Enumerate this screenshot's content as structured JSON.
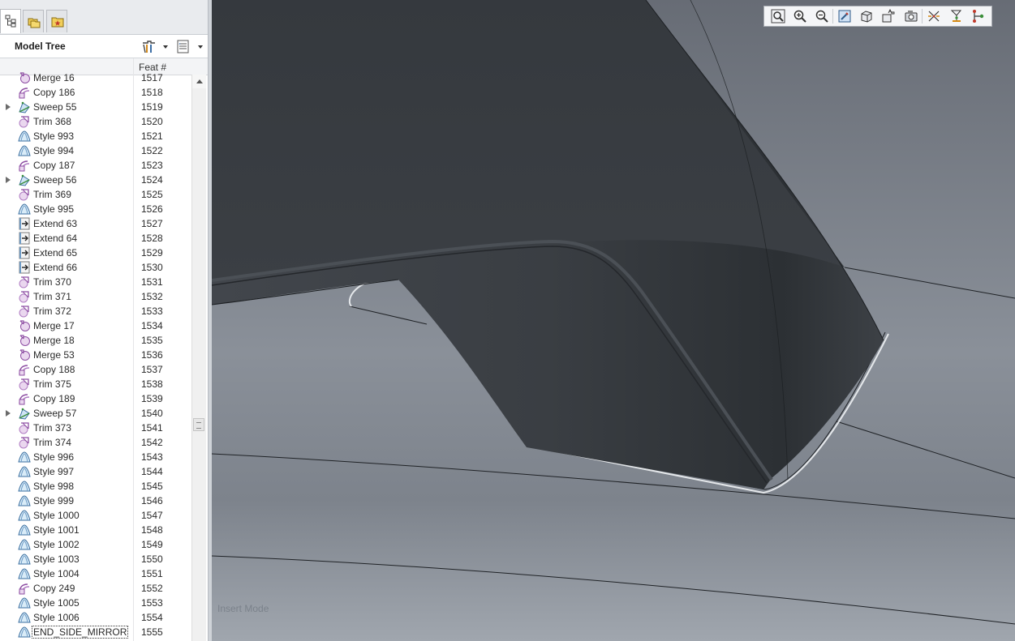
{
  "panel_tabs": [
    {
      "id": "model-tree",
      "icon": "model-tree-icon",
      "active": true
    },
    {
      "id": "folder-browser",
      "icon": "folder-browser-icon",
      "active": false
    },
    {
      "id": "favorites",
      "icon": "favorites-icon",
      "active": false
    }
  ],
  "model_tree": {
    "title": "Model Tree",
    "settings_icon": "tree-settings-icon",
    "columns_icon": "tree-columns-icon",
    "column_feat": "Feat #",
    "rows": [
      {
        "name": "Merge 16",
        "feat": "1517",
        "type": "merge",
        "expandable": false
      },
      {
        "name": "Copy 186",
        "feat": "1518",
        "type": "copy",
        "expandable": false
      },
      {
        "name": "Sweep 55",
        "feat": "1519",
        "type": "sweep",
        "expandable": true
      },
      {
        "name": "Trim 368",
        "feat": "1520",
        "type": "trim",
        "expandable": false
      },
      {
        "name": "Style 993",
        "feat": "1521",
        "type": "style",
        "expandable": false
      },
      {
        "name": "Style 994",
        "feat": "1522",
        "type": "style",
        "expandable": false
      },
      {
        "name": "Copy 187",
        "feat": "1523",
        "type": "copy",
        "expandable": false
      },
      {
        "name": "Sweep 56",
        "feat": "1524",
        "type": "sweep",
        "expandable": true
      },
      {
        "name": "Trim 369",
        "feat": "1525",
        "type": "trim",
        "expandable": false
      },
      {
        "name": "Style 995",
        "feat": "1526",
        "type": "style",
        "expandable": false
      },
      {
        "name": "Extend 63",
        "feat": "1527",
        "type": "extend",
        "expandable": false
      },
      {
        "name": "Extend 64",
        "feat": "1528",
        "type": "extend",
        "expandable": false
      },
      {
        "name": "Extend 65",
        "feat": "1529",
        "type": "extend",
        "expandable": false
      },
      {
        "name": "Extend 66",
        "feat": "1530",
        "type": "extend",
        "expandable": false
      },
      {
        "name": "Trim 370",
        "feat": "1531",
        "type": "trim",
        "expandable": false
      },
      {
        "name": "Trim 371",
        "feat": "1532",
        "type": "trim",
        "expandable": false
      },
      {
        "name": "Trim 372",
        "feat": "1533",
        "type": "trim",
        "expandable": false
      },
      {
        "name": "Merge 17",
        "feat": "1534",
        "type": "merge",
        "expandable": false
      },
      {
        "name": "Merge 18",
        "feat": "1535",
        "type": "merge",
        "expandable": false
      },
      {
        "name": "Merge 53",
        "feat": "1536",
        "type": "merge",
        "expandable": false
      },
      {
        "name": "Copy 188",
        "feat": "1537",
        "type": "copy",
        "expandable": false
      },
      {
        "name": "Trim 375",
        "feat": "1538",
        "type": "trim",
        "expandable": false
      },
      {
        "name": "Copy 189",
        "feat": "1539",
        "type": "copy",
        "expandable": false
      },
      {
        "name": "Sweep 57",
        "feat": "1540",
        "type": "sweep",
        "expandable": true
      },
      {
        "name": "Trim 373",
        "feat": "1541",
        "type": "trim",
        "expandable": false
      },
      {
        "name": "Trim 374",
        "feat": "1542",
        "type": "trim",
        "expandable": false
      },
      {
        "name": "Style 996",
        "feat": "1543",
        "type": "style",
        "expandable": false
      },
      {
        "name": "Style 997",
        "feat": "1544",
        "type": "style",
        "expandable": false
      },
      {
        "name": "Style 998",
        "feat": "1545",
        "type": "style",
        "expandable": false
      },
      {
        "name": "Style 999",
        "feat": "1546",
        "type": "style",
        "expandable": false
      },
      {
        "name": "Style 1000",
        "feat": "1547",
        "type": "style",
        "expandable": false
      },
      {
        "name": "Style 1001",
        "feat": "1548",
        "type": "style",
        "expandable": false
      },
      {
        "name": "Style 1002",
        "feat": "1549",
        "type": "style",
        "expandable": false
      },
      {
        "name": "Style 1003",
        "feat": "1550",
        "type": "style",
        "expandable": false
      },
      {
        "name": "Style 1004",
        "feat": "1551",
        "type": "style",
        "expandable": false
      },
      {
        "name": "Copy 249",
        "feat": "1552",
        "type": "copy",
        "expandable": false
      },
      {
        "name": "Style 1005",
        "feat": "1553",
        "type": "style",
        "expandable": false
      },
      {
        "name": "Style 1006",
        "feat": "1554",
        "type": "style",
        "expandable": false
      },
      {
        "name": "END_SIDE_MIRROR",
        "feat": "1555",
        "type": "style",
        "expandable": false,
        "selected": true
      }
    ]
  },
  "viewport": {
    "mode_label": "Insert Mode",
    "colors": {
      "background_top": "#6b7079",
      "background_bottom": "#9aa1aa",
      "part_dark": "#383c41",
      "edge": "#1e2226"
    }
  },
  "view_toolbar": [
    {
      "name": "refit-icon"
    },
    {
      "name": "zoom-in-icon"
    },
    {
      "name": "zoom-out-icon"
    },
    {
      "name": "repaint-icon"
    },
    {
      "name": "display-style-icon"
    },
    {
      "name": "saved-orientations-icon"
    },
    {
      "name": "view-manager-icon"
    },
    {
      "name": "datum-display-icon"
    },
    {
      "name": "annotation-display-icon"
    },
    {
      "name": "spin-center-icon"
    }
  ]
}
